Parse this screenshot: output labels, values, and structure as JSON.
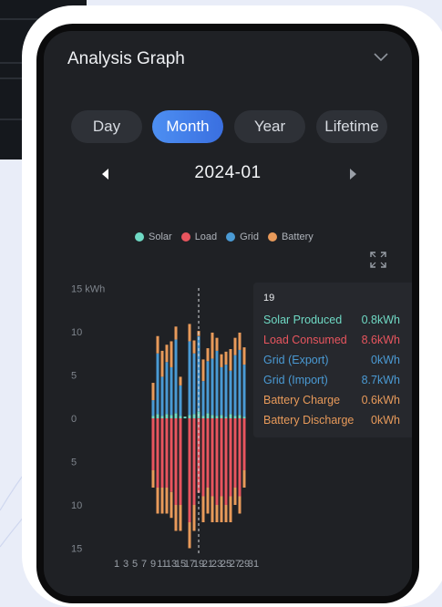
{
  "title": "Analysis Graph",
  "tabs": [
    {
      "label": "Day",
      "active": false
    },
    {
      "label": "Month",
      "active": true
    },
    {
      "label": "Year",
      "active": false
    },
    {
      "label": "Lifetime",
      "active": false
    }
  ],
  "period": "2024-01",
  "legend": [
    {
      "label": "Solar",
      "color": "#6fd9c4"
    },
    {
      "label": "Load",
      "color": "#e8555e"
    },
    {
      "label": "Grid",
      "color": "#4a9ad4"
    },
    {
      "label": "Battery",
      "color": "#e89a5a"
    }
  ],
  "tooltip": {
    "day": "19",
    "rows": [
      {
        "label": "Solar Produced",
        "value": "0.8kWh",
        "color": "#6fd9c4"
      },
      {
        "label": "Load Consumed",
        "value": "8.6kWh",
        "color": "#e8555e"
      },
      {
        "label": "Grid (Export)",
        "value": "0kWh",
        "color": "#4a9ad4"
      },
      {
        "label": "Grid (Import)",
        "value": "8.7kWh",
        "color": "#4a9ad4"
      },
      {
        "label": "Battery Charge",
        "value": "0.6kWh",
        "color": "#e89a5a"
      },
      {
        "label": "Battery Discharge",
        "value": "0kWh",
        "color": "#e89a5a"
      }
    ]
  },
  "chart_data": {
    "type": "bar",
    "y_tick_labels": [
      "15 kWh",
      "10",
      "5",
      "0",
      "5",
      "10",
      "15"
    ],
    "y_ticks": [
      15,
      10,
      5,
      0,
      -5,
      -10,
      -15
    ],
    "ylim": [
      -15,
      15
    ],
    "x_tick_labels": [
      "1",
      "3",
      "5",
      "7",
      "9",
      "11",
      "13",
      "15",
      "17",
      "19",
      "21",
      "23",
      "25",
      "27",
      "29",
      "31"
    ],
    "days": [
      1,
      2,
      3,
      4,
      5,
      6,
      7,
      8,
      9,
      10,
      11,
      12,
      13,
      14,
      15,
      16,
      17,
      18,
      19,
      20,
      21,
      22,
      23,
      24,
      25,
      26,
      27,
      28,
      29,
      30,
      31
    ],
    "series": [
      {
        "name": "Solar",
        "color": "#6fd9c4",
        "values": [
          0,
          0,
          0,
          0,
          0,
          0,
          0,
          0,
          0.3,
          0.5,
          0.3,
          0.5,
          0.4,
          0.6,
          0.3,
          0.2,
          0.4,
          0.5,
          0.8,
          0.3,
          0.6,
          0.4,
          0.3,
          0.4,
          0.2,
          0.5,
          0.3,
          0.4,
          0.2,
          0,
          0
        ]
      },
      {
        "name": "Grid import",
        "color": "#4a9ad4",
        "values": [
          0,
          0,
          0,
          0,
          0,
          0,
          0,
          0,
          1.8,
          7,
          4.5,
          6,
          5.5,
          8.5,
          3.5,
          0,
          8.5,
          7,
          8.7,
          4,
          6,
          6.5,
          7.5,
          5.5,
          6,
          5,
          7,
          7.5,
          6,
          0,
          0
        ]
      },
      {
        "name": "Battery charge",
        "color": "#e89a5a",
        "values": [
          0,
          0,
          0,
          0,
          0,
          0,
          0,
          0,
          2,
          2,
          3,
          2,
          3,
          1.5,
          1,
          0,
          2,
          1.5,
          0.6,
          2.5,
          1.5,
          3,
          1.5,
          1.5,
          1.5,
          2.5,
          2,
          2,
          2,
          0,
          0
        ]
      },
      {
        "name": "Load",
        "color": "#e8555e",
        "values": [
          0,
          0,
          0,
          0,
          0,
          0,
          0,
          0,
          -6,
          -8,
          -8,
          -8,
          -8.5,
          -10,
          -10,
          0,
          -12,
          -10,
          -8.6,
          -9,
          -8,
          -9,
          -10,
          -9,
          -10,
          -9,
          -8,
          -9,
          -6,
          0,
          0
        ]
      },
      {
        "name": "Battery discharge",
        "color": "#e89a5a",
        "values": [
          0,
          0,
          0,
          0,
          0,
          0,
          0,
          0,
          -2,
          -3,
          -3,
          -3,
          -3,
          -3,
          -3,
          0,
          -3,
          -3,
          0,
          -3,
          -3,
          -3,
          -2,
          -3,
          -2,
          -3,
          -2,
          -2,
          -2,
          0,
          0
        ]
      }
    ]
  }
}
